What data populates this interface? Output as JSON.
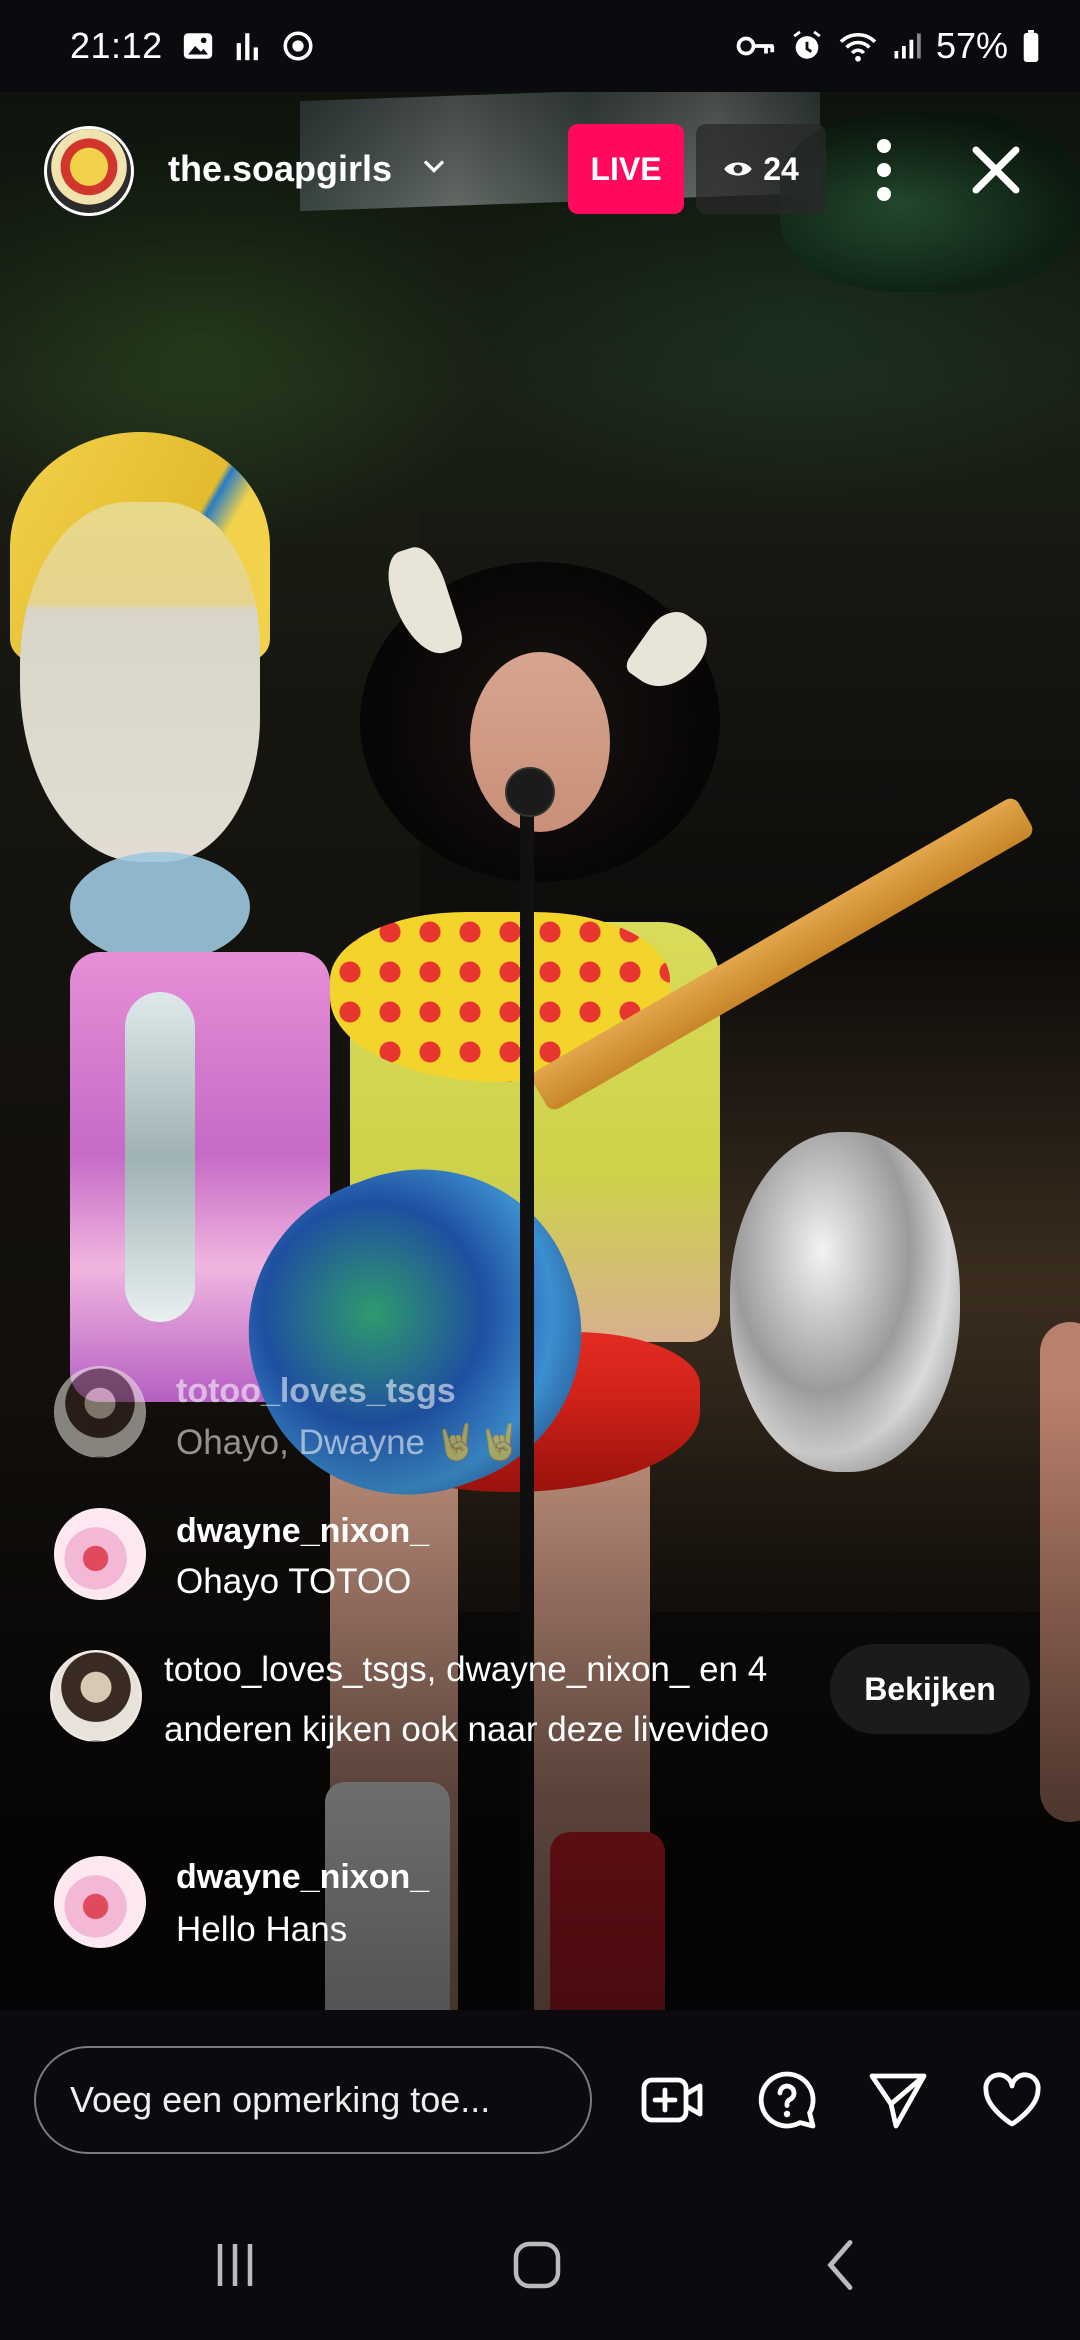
{
  "status_bar": {
    "time": "21:12",
    "battery": "57%",
    "icons": [
      "gallery-icon",
      "chart-icon",
      "vpn-icon",
      "key-icon",
      "alarm-icon",
      "wifi-icon",
      "signal-icon",
      "battery-icon"
    ]
  },
  "header": {
    "username": "the.soapgirls",
    "live_label": "LIVE",
    "viewer_count": "24"
  },
  "comments": [
    {
      "user": "totoo_loves_tsgs",
      "text": "Ohayo, Dwayne 🤘🤘"
    },
    {
      "user": "dwayne_nixon_",
      "text": "Ohayo TOTOO"
    }
  ],
  "join_notice": {
    "text": "totoo_loves_tsgs, dwayne_nixon_ en 4 anderen kijken ook naar deze livevideo",
    "button_label": "Bekijken"
  },
  "last_comment": {
    "user": "dwayne_nixon_",
    "text": "Hello Hans"
  },
  "bottom_bar": {
    "comment_placeholder": "Voeg een opmerking toe...",
    "icons": [
      "add-video-icon",
      "question-icon",
      "send-icon",
      "heart-icon"
    ]
  },
  "navigation": [
    "recents-icon",
    "home-icon",
    "back-icon"
  ],
  "colors": {
    "live": "#ff0a5c",
    "background": "#0b0b0f"
  }
}
